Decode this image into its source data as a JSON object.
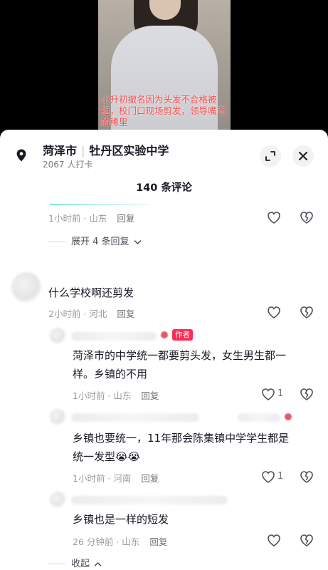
{
  "video": {
    "caption": "小升初撤名因为头发不合格被拒，校门口现场剪发，领导嘴咒的稀里"
  },
  "location": {
    "city": "菏泽市",
    "place": "牡丹区实验中学",
    "checkins": "2067 人打卡"
  },
  "comments_count": "140 条评论",
  "thread1": {
    "time_loc": "1小时前 · 山东",
    "reply": "回复",
    "expand": "展开 4 条回复"
  },
  "comment2": {
    "text": "什么学校啊还剪发",
    "time_loc": "2小时前 · 河北",
    "reply": "回复"
  },
  "reply1": {
    "badge": "作者",
    "text_line1": "菏泽市的中学统一都要剪头发，女生男生都一",
    "text_line2": "样。乡镇的不用",
    "time_loc": "1小时前 · 山东",
    "reply": "回复",
    "likes": "1"
  },
  "reply2": {
    "text_line1": "乡镇也要统一，11年那会陈集镇中学学生都是",
    "text_line2": "统一发型",
    "emoji": "😭😭",
    "time_loc": "1小时前 · 河南",
    "reply": "回复",
    "likes": "1"
  },
  "reply3": {
    "text": "乡镇也是一样的短发",
    "time_loc": "26 分钟前 · 山东",
    "reply": "回复"
  },
  "collapse": "收起",
  "colors": {
    "text": "#161823",
    "meta": "#9a9aa0",
    "badge": "#fe2c55"
  }
}
